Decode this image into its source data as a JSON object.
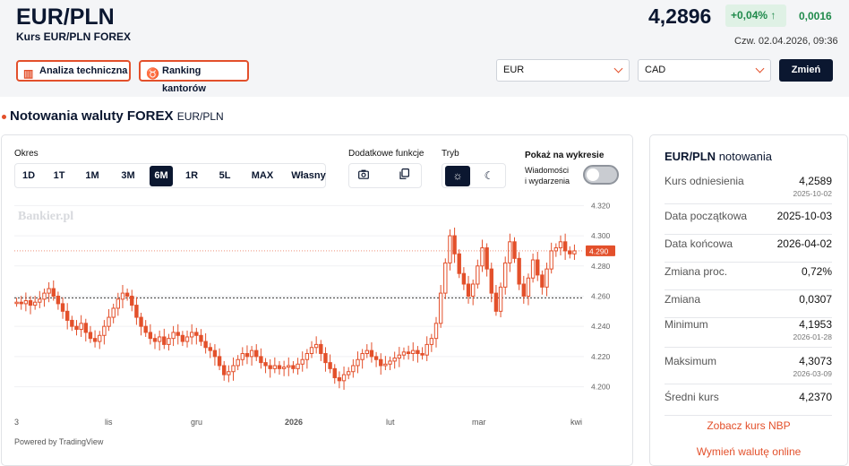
{
  "header": {
    "title": "EUR/PLN",
    "subtitle": "Kurs EUR/PLN FOREX",
    "price": "4,2896",
    "change_pct": "+0,04%",
    "change_abs": "0,0016",
    "timestamp": "Czw. 02.04.2026, 09:36",
    "analysis_button": "Analiza techniczna",
    "ranking_button": "Ranking kantorów",
    "from_currency": "EUR",
    "to_currency": "CAD",
    "change_button": "Zmień",
    "colors": {
      "accent": "#e3502b",
      "positive": "#1f8a4b",
      "navy": "#0b1730"
    }
  },
  "section": {
    "title": "Notowania waluty FOREX",
    "pair": "EUR/PLN"
  },
  "controls": {
    "period_label": "Okres",
    "periods": [
      "1D",
      "1T",
      "1M",
      "3M",
      "6M",
      "1R",
      "5L",
      "MAX",
      "Własny"
    ],
    "active_period": "6M",
    "extra_label": "Dodatkowe funkcje",
    "mode_label": "Tryb",
    "show_label": "Pokaż na wykresie",
    "news_line1": "Wiadomości",
    "news_line2": "i wydarzenia",
    "news_enabled": false
  },
  "chart_data": {
    "type": "candlestick",
    "watermark": "Bankier.pl",
    "x_tick_labels": [
      "3",
      "lis",
      "gru",
      "2026",
      "lut",
      "mar",
      "kwi"
    ],
    "y_tick_labels": [
      "4.320",
      "4.300",
      "4.280",
      "4.260",
      "4.240",
      "4.220",
      "4.200"
    ],
    "ylim": [
      4.195,
      4.322
    ],
    "reference_line": 4.2589,
    "last_value_label": "4.290",
    "up_color": "#e3502b",
    "down_color": "#e3502b",
    "closes": [
      4.256,
      4.255,
      4.257,
      4.254,
      4.256,
      4.258,
      4.262,
      4.265,
      4.26,
      4.255,
      4.25,
      4.244,
      4.24,
      4.238,
      4.242,
      4.236,
      4.232,
      4.23,
      4.234,
      4.24,
      4.246,
      4.252,
      4.258,
      4.262,
      4.26,
      4.254,
      4.246,
      4.24,
      4.236,
      4.232,
      4.23,
      4.233,
      4.228,
      4.232,
      4.236,
      4.234,
      4.23,
      4.233,
      4.236,
      4.234,
      4.23,
      4.226,
      4.224,
      4.22,
      4.214,
      4.208,
      4.21,
      4.214,
      4.218,
      4.222,
      4.22,
      4.224,
      4.22,
      4.216,
      4.214,
      4.212,
      4.214,
      4.212,
      4.213,
      4.214,
      4.212,
      4.215,
      4.218,
      4.222,
      4.226,
      4.228,
      4.222,
      4.216,
      4.212,
      4.206,
      4.204,
      4.208,
      4.21,
      4.214,
      4.218,
      4.222,
      4.224,
      4.22,
      4.218,
      4.214,
      4.215,
      4.217,
      4.219,
      4.221,
      4.223,
      4.222,
      4.224,
      4.222,
      4.221,
      4.228,
      4.232,
      4.242,
      4.262,
      4.282,
      4.3,
      4.288,
      4.275,
      4.268,
      4.26,
      4.268,
      4.28,
      4.292,
      4.278,
      4.262,
      4.25,
      4.266,
      4.282,
      4.296,
      4.285,
      4.268,
      4.26,
      4.272,
      4.284,
      4.274,
      4.266,
      4.278,
      4.29,
      4.292,
      4.296,
      4.29,
      4.288,
      4.29
    ],
    "x_axis_note": "Powered by TradingView"
  },
  "stats": {
    "title": "EUR/PLN",
    "title_suffix": "notowania",
    "rows": [
      {
        "label": "Kurs odniesienia",
        "value": "4,2589",
        "date": "2025-10-02"
      },
      {
        "label": "Data początkowa",
        "value": "2025-10-03",
        "date": ""
      },
      {
        "label": "Data końcowa",
        "value": "2026-04-02",
        "date": ""
      },
      {
        "label": "Zmiana proc.",
        "value": "0,72%",
        "date": ""
      },
      {
        "label": "Zmiana",
        "value": "0,0307",
        "date": ""
      },
      {
        "label": "Minimum",
        "value": "4,1953",
        "date": "2026-01-28"
      },
      {
        "label": "Maksimum",
        "value": "4,3073",
        "date": "2026-03-09"
      },
      {
        "label": "Średni kurs",
        "value": "4,2370",
        "date": ""
      }
    ],
    "link_nbp": "Zobacz kurs NBP",
    "link_exchange": "Wymień walutę online"
  }
}
